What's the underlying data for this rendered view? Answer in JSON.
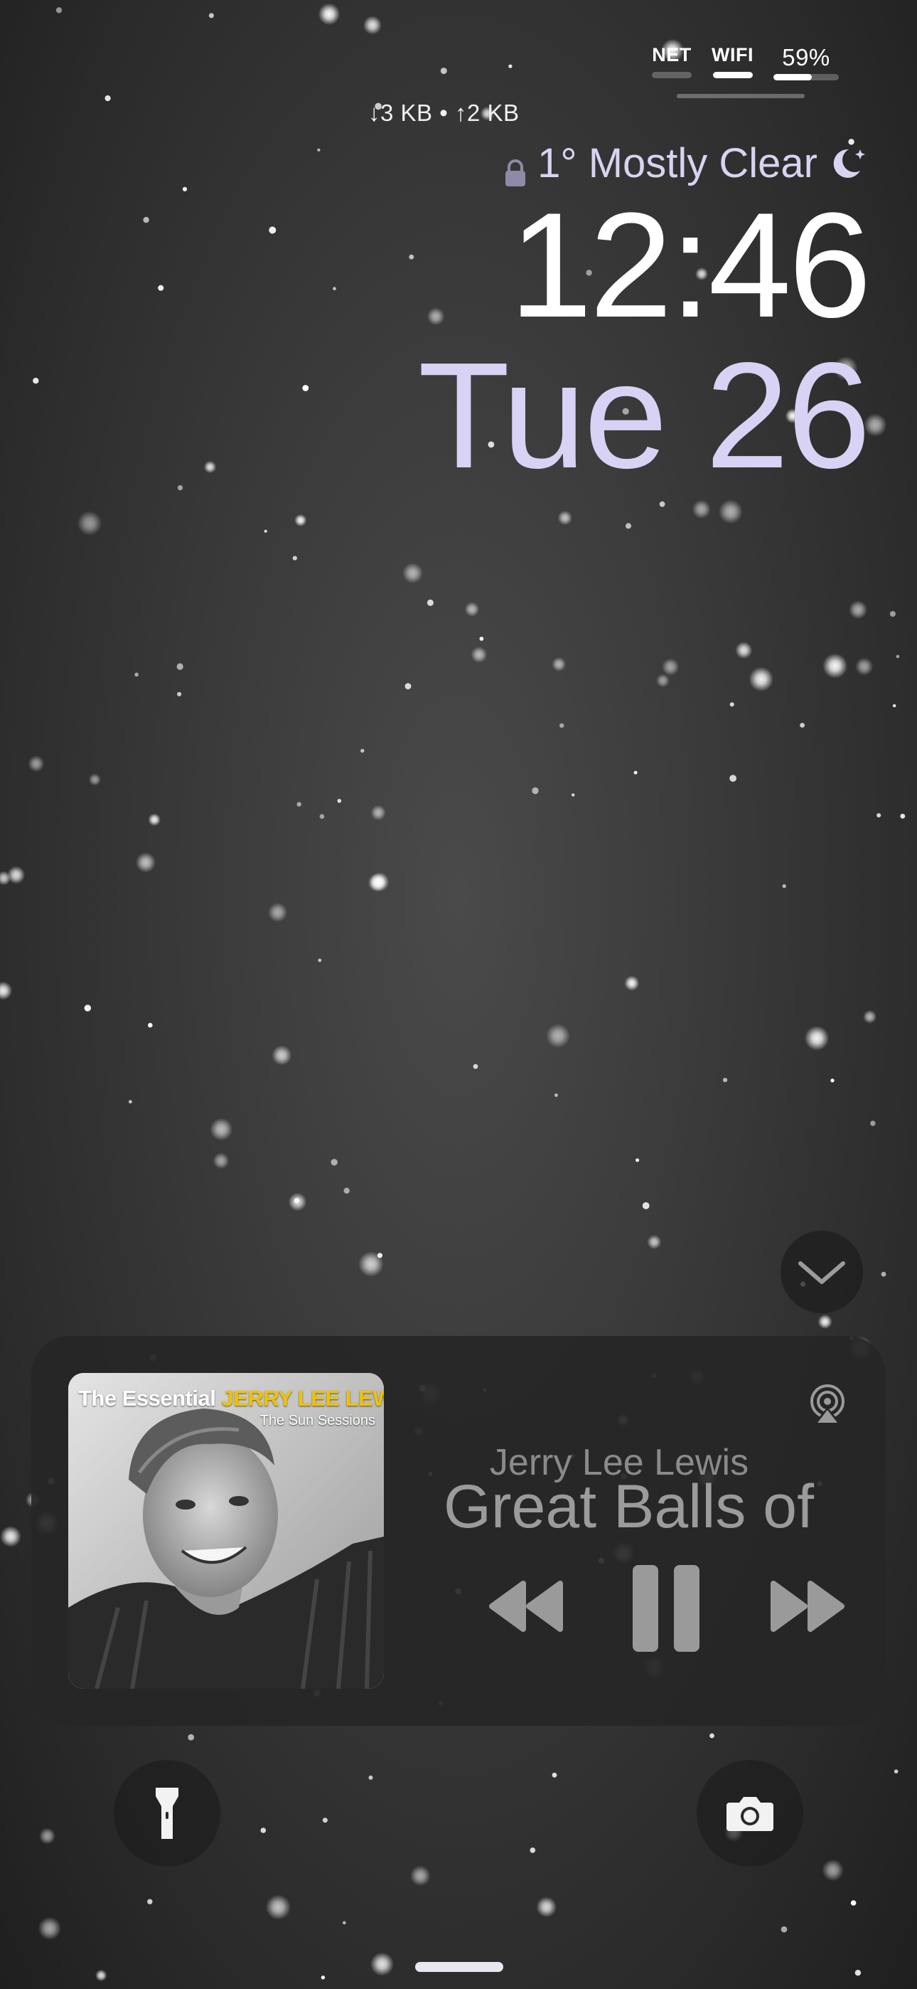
{
  "status": {
    "net_label": "NET",
    "wifi_label": "WIFI",
    "battery_label": "59%",
    "battery_level": 0.59,
    "wifi_level": 1.0,
    "net_level": 0.0
  },
  "network_speed": "↓3 KB • ↑2 KB",
  "weather": {
    "text": "1° Mostly Clear",
    "condition_icon": "moon-icon",
    "lock_icon": "lock-icon"
  },
  "lock_screen": {
    "time": "12:46",
    "date": "Tue 26"
  },
  "now_playing": {
    "artwork": {
      "title_prefix": "The Essential ",
      "title_artist": "JERRY LEE LEWIS",
      "subtitle": "The Sun Sessions"
    },
    "artist": "Jerry Lee Lewis",
    "song": "Great Balls of",
    "airplay_icon": "airplay-icon",
    "controls": [
      "rewind-icon",
      "pause-icon",
      "fast-forward-icon"
    ]
  },
  "shortcuts": {
    "left": "flashlight-icon",
    "right": "camera-icon"
  },
  "colors": {
    "date": "#d8d2f4",
    "weather": "#d9d3f2",
    "widget_bg": "#262626",
    "control_gray": "#9a9a9a"
  }
}
